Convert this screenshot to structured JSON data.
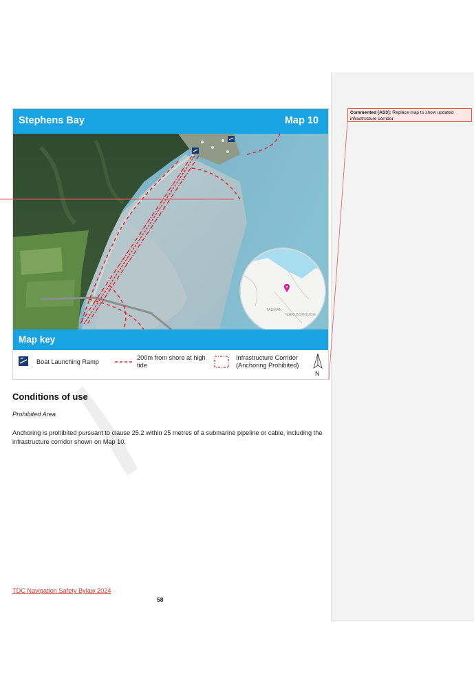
{
  "map": {
    "title": "Stephens Bay",
    "map_number": "Map 10",
    "inset_labels": {
      "west": "TASMAN",
      "east": "MARLBOROUGH"
    },
    "key_title": "Map key",
    "legend": [
      {
        "label": "Boat Launching Ramp",
        "icon": "boat-ramp-icon"
      },
      {
        "label": "200m from shore at high tide",
        "icon": "dashed-line-icon"
      },
      {
        "label": "Infrastructure Corridor (Anchoring Prohibited)",
        "icon": "corridor-icon"
      }
    ],
    "north_label": "N",
    "colors": {
      "header": "#1aa3e2",
      "route": "#e8242c",
      "pin": "#e0169a"
    }
  },
  "comment": {
    "author": "Commented [AS3]:",
    "text": "Replace map to show updated infrastructure corridor"
  },
  "section": {
    "heading": "Conditions of use",
    "subheading": "Prohibited Area",
    "paragraph": "Anchoring is prohibited pursuant to clause 25.2 within 25 metres of a submarine pipeline or cable, including the infrastructure corridor shown on Map 10."
  },
  "footer": {
    "link": "TDC Navigation Safety Bylaw 2024",
    "page_number": "58"
  }
}
